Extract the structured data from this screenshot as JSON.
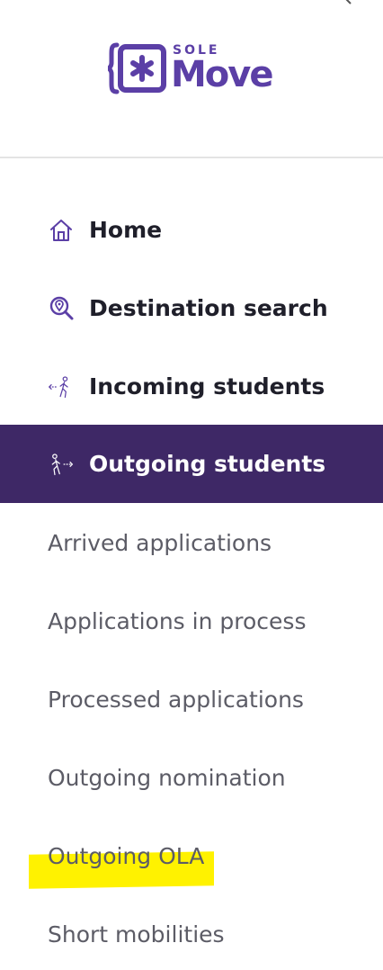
{
  "brand": {
    "logo_small": "SOLE",
    "logo_large": "Move",
    "color": "#5b3fa6"
  },
  "header": {
    "collapse_icon": "chevron-left-icon"
  },
  "nav": {
    "items": [
      {
        "label": "Home",
        "icon": "home-icon"
      },
      {
        "label": "Destination search",
        "icon": "map-search-icon"
      },
      {
        "label": "Incoming students",
        "icon": "incoming-walker-icon"
      },
      {
        "label": "Outgoing students",
        "icon": "outgoing-walker-icon",
        "active": true
      }
    ],
    "active_bg": "#3e2866"
  },
  "subnav": {
    "items": [
      {
        "label": "Arrived applications"
      },
      {
        "label": "Applications in process"
      },
      {
        "label": "Processed applications"
      },
      {
        "label": "Outgoing nomination"
      },
      {
        "label": "Outgoing OLA",
        "highlighted": true
      },
      {
        "label": "Short mobilities"
      }
    ],
    "highlight_color": "#fff200"
  }
}
